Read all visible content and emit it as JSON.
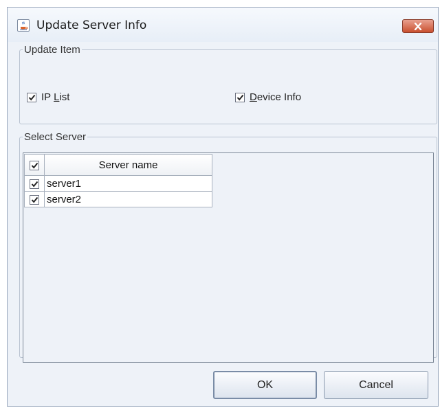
{
  "window": {
    "title": "Update Server Info",
    "icon": "java-cup-icon",
    "close_icon": "close-icon"
  },
  "update_item": {
    "legend": "Update Item",
    "ip_list": {
      "label_pre": "IP ",
      "mnemonic": "L",
      "label_post": "ist",
      "checked": true
    },
    "device_info": {
      "label_pre": "",
      "mnemonic": "D",
      "label_post": "evice Info",
      "checked": true
    }
  },
  "select_server": {
    "legend": "Select Server",
    "header": {
      "select_all_checked": true,
      "column_name": "Server name"
    },
    "rows": [
      {
        "checked": true,
        "name": "server1"
      },
      {
        "checked": true,
        "name": "server2"
      }
    ]
  },
  "buttons": {
    "ok": "OK",
    "cancel": "Cancel"
  }
}
